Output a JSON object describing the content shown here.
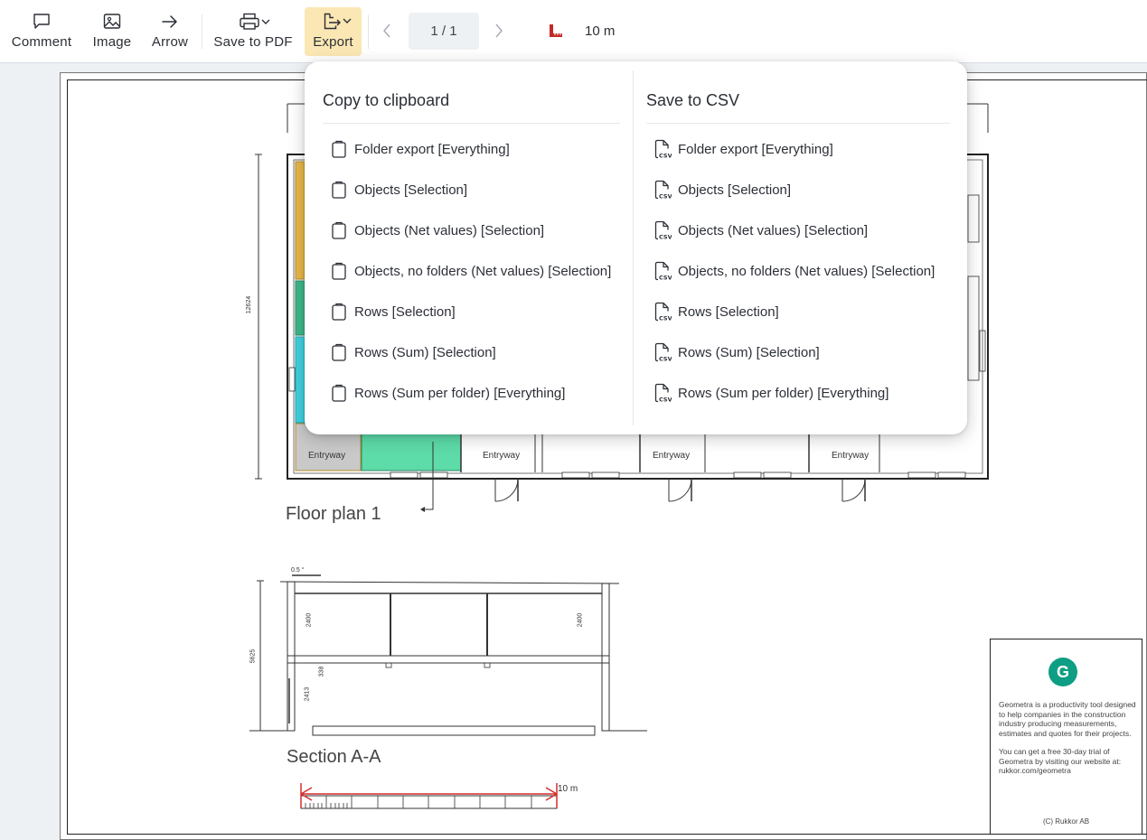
{
  "toolbar": {
    "comment_label": "Comment",
    "image_label": "Image",
    "arrow_label": "Arrow",
    "save_pdf_label": "Save to PDF",
    "export_label": "Export",
    "page_indicator": "1 / 1",
    "measure_value": "10 m"
  },
  "drawing": {
    "floor_plan_title": "Floor plan 1",
    "section_title": "Section A-A",
    "room_label": "Entryway",
    "scale_label": "10 m",
    "dim_12624": "12624",
    "dim_5625": "5625",
    "dim_2400": "2400",
    "dim_338": "338",
    "dim_2413": "2413",
    "slope_label": "0.5 °",
    "info": {
      "logo_letter": "G",
      "paragraph1": "Geometra is a productivity tool designed to help companies in the construction industry producing measurements, estimates and quotes for their projects.",
      "paragraph2": "You can get a free 30-day trial of Geometra by visiting our website at: rukkor.com/geometra",
      "copyright": "(C) Rukkor AB"
    }
  },
  "export_menu": {
    "clipboard": {
      "title": "Copy to clipboard",
      "items": [
        "Folder export [Everything]",
        "Objects [Selection]",
        "Objects (Net values) [Selection]",
        "Objects, no folders (Net values) [Selection]",
        "Rows [Selection]",
        "Rows (Sum) [Selection]",
        "Rows (Sum per folder) [Everything]"
      ]
    },
    "csv": {
      "title": "Save to CSV",
      "items": [
        "Folder export [Everything]",
        "Objects [Selection]",
        "Objects (Net values) [Selection]",
        "Objects, no folders (Net values) [Selection]",
        "Rows [Selection]",
        "Rows (Sum) [Selection]",
        "Rows (Sum per folder) [Everything]"
      ]
    }
  },
  "colors": {
    "export_active_bg": "#fbe7b3",
    "measure_icon": "#c62828",
    "room_orange": "#e8b84a",
    "room_green": "#3fb98a",
    "room_cyan": "#3fd3e0",
    "room_mint": "#5ddba8",
    "logo_green": "#0e9e84"
  }
}
